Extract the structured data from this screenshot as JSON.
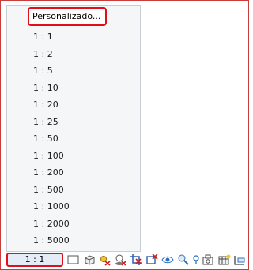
{
  "menu": {
    "custom_label": "Personalizado...",
    "scales": [
      "1 : 1",
      "1 : 2",
      "1 : 5",
      "1 : 10",
      "1 : 20",
      "1 : 25",
      "1 : 50",
      "1 : 100",
      "1 : 200",
      "1 : 500",
      "1 : 1000",
      "1 : 2000",
      "1 : 5000"
    ]
  },
  "statusbar": {
    "current_scale": "1 : 1",
    "icons": [
      "detail-level-icon",
      "visual-style-icon",
      "sun-path-icon",
      "shadows-icon",
      "crop-view-icon",
      "show-crop-region-icon",
      "temporary-hide-icon",
      "reveal-hidden-icon",
      "analytical-model-icon",
      "highlight-displacement-icon",
      "camera-icon",
      "worksharing-icon"
    ]
  }
}
